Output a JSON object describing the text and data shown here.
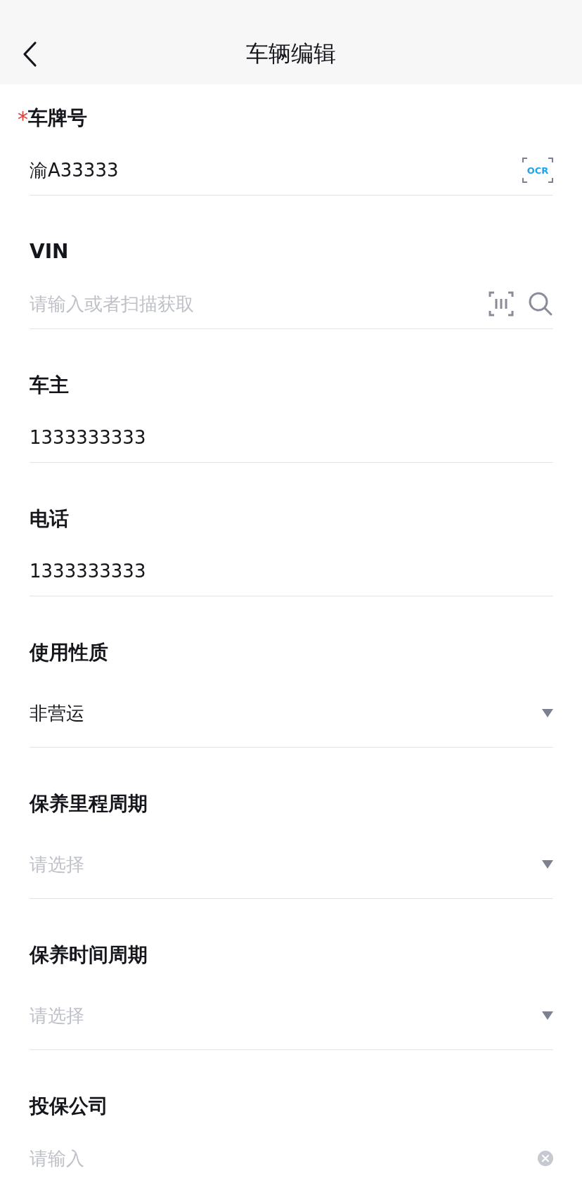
{
  "header": {
    "title": "车辆编辑"
  },
  "fields": [
    {
      "kind": "ocr",
      "label": "车牌号",
      "required_mark": "*",
      "value": "渝A33333",
      "ocr_label": "OCR"
    },
    {
      "kind": "scan",
      "label": "VIN",
      "placeholder": "请输入或者扫描获取"
    },
    {
      "kind": "text",
      "label": "车主",
      "value": "1333333333"
    },
    {
      "kind": "text",
      "label": "电话",
      "value": "1333333333"
    },
    {
      "kind": "select",
      "label": "使用性质",
      "value": "非营运"
    },
    {
      "kind": "select",
      "label": "保养里程周期",
      "placeholder": "请选择"
    },
    {
      "kind": "select",
      "label": "保养时间周期",
      "placeholder": "请选择"
    },
    {
      "kind": "clear",
      "label": "投保公司",
      "placeholder": "请输入"
    }
  ]
}
